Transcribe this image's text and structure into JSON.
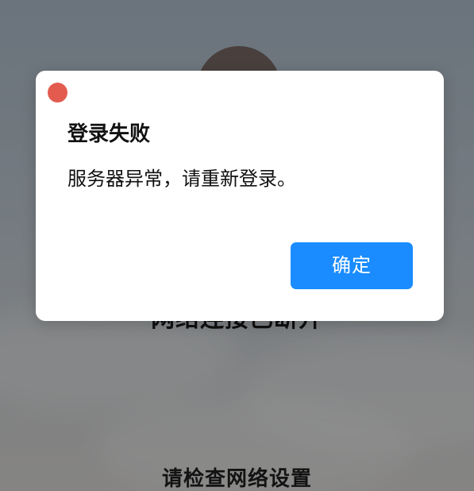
{
  "background": {
    "network_status": "网络连接已断开",
    "hint": "请检查网络设置"
  },
  "dialog": {
    "title": "登录失败",
    "message": "服务器异常，请重新登录。",
    "confirm_label": "确定",
    "close_icon": "red-circle-close-icon"
  },
  "colors": {
    "accent": "#1a8cff",
    "close_dot": "#e35b4f"
  }
}
